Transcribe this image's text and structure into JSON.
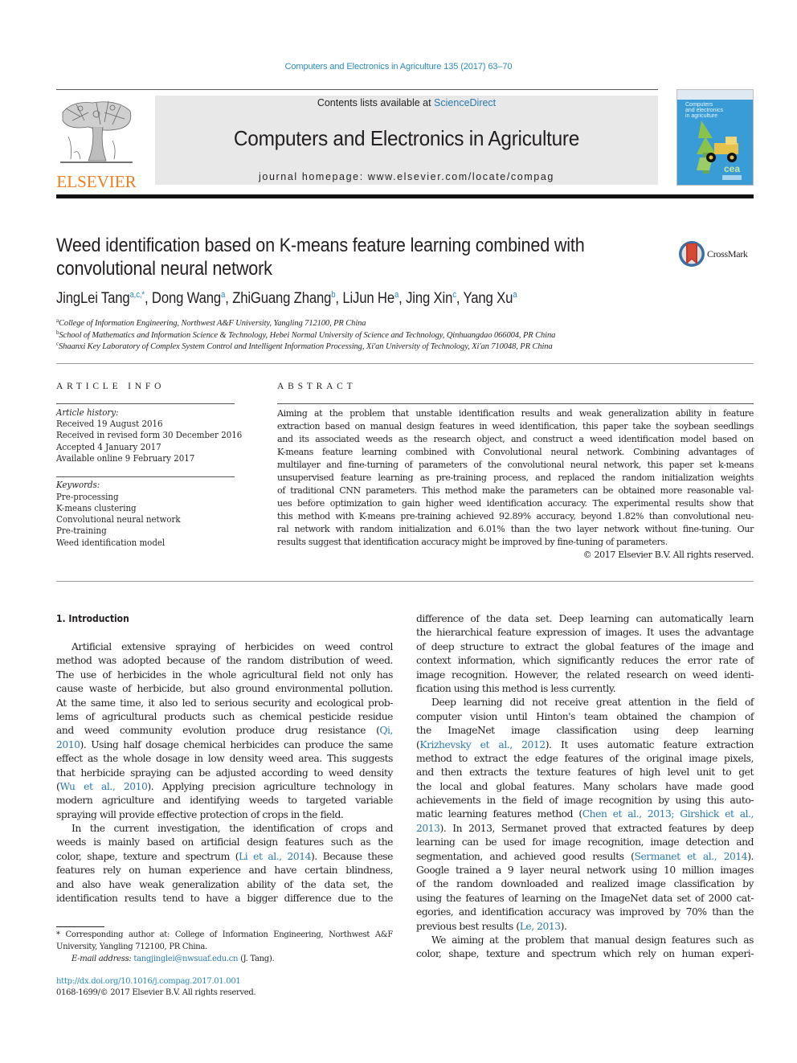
{
  "running_head": "Computers and Electronics in Agriculture 135 (2017) 63–70",
  "masthead": {
    "publisher_logo_text": "ELSEVIER",
    "contents_prefix": "Contents lists available at ",
    "contents_link": "ScienceDirect",
    "journal_title": "Computers and Electronics in Agriculture",
    "homepage_prefix": "journal homepage: ",
    "homepage_url": "www.elsevier.com/locate/compag",
    "cover_title_lines": [
      "Computers",
      "and electronics",
      "in agriculture"
    ]
  },
  "article": {
    "title_line1": "Weed identification based on K-means feature learning combined with",
    "title_line2": "convolutional neural network",
    "crossmark_label": "CrossMark",
    "authors": [
      {
        "name": "JingLei Tang",
        "sup": "a,c,*",
        "sep": ", "
      },
      {
        "name": "Dong Wang",
        "sup": "a",
        "sep": ", "
      },
      {
        "name": "ZhiGuang Zhang",
        "sup": "b",
        "sep": ", "
      },
      {
        "name": "LiJun He",
        "sup": "a",
        "sep": ", "
      },
      {
        "name": "Jing Xin",
        "sup": "c",
        "sep": ", "
      },
      {
        "name": "Yang Xu",
        "sup": "a",
        "sep": ""
      }
    ],
    "affiliations": [
      {
        "key": "a",
        "text": "College of Information Engineering, Northwest A&F University, Yangling 712100, PR China"
      },
      {
        "key": "b",
        "text": "School of Mathematics and Information Science & Technology, Hebei Normal University of Science and Technology, Qinhuangdao 066004, PR China"
      },
      {
        "key": "c",
        "text": "Shaanxi Key Laboratory of Complex System Control and Intelligent Information Processing, Xi'an University of Technology, Xi'an 710048, PR China"
      }
    ]
  },
  "article_info": {
    "heading": "ARTICLE INFO",
    "history_label": "Article history:",
    "history": [
      "Received 19 August 2016",
      "Received in revised form 30 December 2016",
      "Accepted 4 January 2017",
      "Available online 9 February 2017"
    ],
    "keywords_label": "Keywords:",
    "keywords": [
      "Pre-processing",
      "K-means clustering",
      "Convolutional neural network",
      "Pre-training",
      "Weed identification model"
    ]
  },
  "abstract": {
    "heading": "ABSTRACT",
    "lines": [
      "Aiming at the problem that unstable identification results and weak generalization ability in feature",
      "extraction based on manual design features in weed identification, this paper take the soybean seedlings",
      "and its associated weeds as the research object, and construct a weed identification model based on",
      "K-means feature learning combined with Convolutional neural network. Combining advantages of",
      "multilayer and fine-turning of parameters of the convolutional neural network, this paper set k-means",
      "unsupervised feature learning as pre-training process, and replaced the random initialization weights",
      "of traditional CNN parameters. This method make the parameters can be obtained more reasonable val-",
      "ues before optimization to gain higher weed identification accuracy. The experimental results show that",
      "this method with K-means pre-training achieved 92.89% accuracy, beyond 1.82% than convolutional neu-",
      "ral network with random initialization and 6.01% than the two layer network without fine-tuning. Our",
      "results suggest that identification accuracy might be improved by fine-tuning of parameters."
    ],
    "copyright": "© 2017 Elsevier B.V. All rights reserved."
  },
  "body": {
    "section_heading": "1. Introduction",
    "left_column": [
      {
        "t": "Artificial extensive spraying of herbicides on weed control",
        "indent": true
      },
      {
        "t": "method was adopted because of the random distribution of weed."
      },
      {
        "t": "The use of herbicides in the whole agricultural field not only has"
      },
      {
        "t": "cause waste of herbicide, but also ground environmental pollution."
      },
      {
        "t": "At the same time, it also led to serious security and ecological prob-"
      },
      {
        "t": "lems of agricultural products such as chemical pesticide residue"
      },
      {
        "t": "and weed community evolution produce drug resistance (",
        "link": "Qi,",
        "after": ""
      },
      {
        "link": "2010",
        "after": "). Using half dosage chemical herbicides can produce the same"
      },
      {
        "t": "effect as the whole dosage in low density weed area. This suggests"
      },
      {
        "t": "that herbicide spraying can be adjusted according to weed density"
      },
      {
        "t": "(",
        "link": "Wu et al., 2010",
        "after": "). Applying precision agriculture technology in"
      },
      {
        "t": "modern agriculture and identifying weeds to targeted variable"
      },
      {
        "t": "spraying will provide effective protection of crops in the field.",
        "last": true
      },
      {
        "t": "In the current investigation, the identification of crops and",
        "indent": true
      },
      {
        "t": "weeds is mainly based on artificial design features such as the"
      },
      {
        "t": "color, shape, texture and spectrum (",
        "link": "Li et al., 2014",
        "after": "). Because these"
      },
      {
        "t": "features rely on human experience and have certain blindness,"
      },
      {
        "t": "and also have weak generalization ability of the data set, the"
      },
      {
        "t": "identification results tend to have a bigger difference due to the"
      }
    ],
    "right_column": [
      {
        "t": "difference of the data set. Deep learning can automatically learn"
      },
      {
        "t": "the hierarchical feature expression of images. It uses the advantage"
      },
      {
        "t": "of deep structure to extract the global features of the image and"
      },
      {
        "t": "context information, which significantly reduces the error rate of"
      },
      {
        "t": "image recognition. However, the related research on weed identi-"
      },
      {
        "t": "fication using this method is less currently.",
        "last": true
      },
      {
        "t": "Deep learning did not receive great attention in the field of",
        "indent": true
      },
      {
        "t": "computer vision until Hinton's team obtained the champion of"
      },
      {
        "t": "the ImageNet image classification using deep learning"
      },
      {
        "t": "(",
        "link": "Krizhevsky et al., 2012",
        "after": "). It uses automatic feature extraction"
      },
      {
        "t": "method to extract the edge features of the original image pixels,"
      },
      {
        "t": "and then extracts the texture features of high level unit to get"
      },
      {
        "t": "the local and global features. Many scholars have made good"
      },
      {
        "t": "achievements in the field of image recognition by using this auto-"
      },
      {
        "t": "matic learning features method (",
        "link": "Chen et al., 2013; Girshick et al.,",
        "after": ""
      },
      {
        "link": "2013",
        "after": "). In 2013, Sermanet proved that extracted features by deep"
      },
      {
        "t": "learning can be used for image recognition, image detection and"
      },
      {
        "t": "segmentation, and achieved good results (",
        "link": "Sermanet et al., 2014",
        "after": ")."
      },
      {
        "t": "Google trained a 9 layer neural network using 10 million images"
      },
      {
        "t": "of the random downloaded and realized image classification by"
      },
      {
        "t": "using the features of learning on the ImageNet data set of 2000 cat-"
      },
      {
        "t": "egories, and identification accuracy was improved by 70% than the"
      },
      {
        "t": "previous best results (",
        "link": "Le, 2013",
        "after": ").",
        "last": true
      },
      {
        "t": "We aiming at the problem that manual design features such as",
        "indent": true
      },
      {
        "t": "color, shape, texture and spectrum which rely on human experi-"
      }
    ]
  },
  "footnotes": {
    "corresponding_line1": " * Corresponding author at: College of Information Engineering, Northwest A&F",
    "corresponding_line2": "University, Yangling 712100, PR China.",
    "email_label": "E-mail address: ",
    "email": "tangjinglei@nwsuaf.edu.cn",
    "email_after": " (J. Tang).",
    "doi": "http://dx.doi.org/10.1016/j.compag.2017.01.001",
    "issn": "0168-1699/© 2017 Elsevier B.V. All rights reserved."
  },
  "colors": {
    "link": "#2a7ab0",
    "elsevier_orange": "#f07d1e",
    "masthead_bg": "#e8e8e8",
    "cover_blue": "#3a9cd7"
  }
}
